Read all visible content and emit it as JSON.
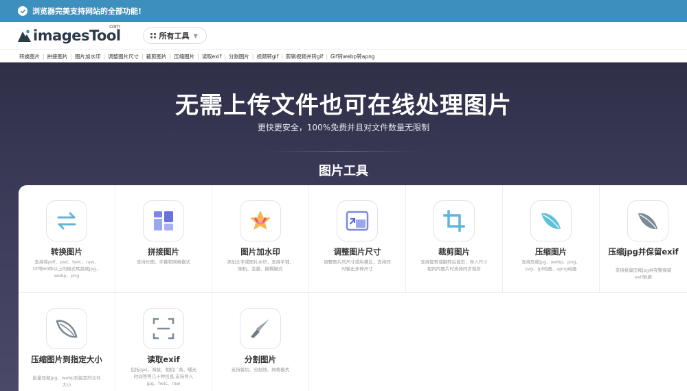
{
  "notice": {
    "text": "浏览器完美支持网站的全部功能!"
  },
  "header": {
    "logo_text": "imagesTool",
    "logo_com": "com",
    "tools_button": "所有工具"
  },
  "subnav": [
    "转换图片",
    "拼接图片",
    "图片加水印",
    "调整图片尺寸",
    "裁剪图片",
    "压缩图片",
    "读取exif",
    "分割图片",
    "视频转gif",
    "剪辑视频并转gif",
    "Gif转webp转apng"
  ],
  "hero": {
    "title": "无需上传文件也可在线处理图片",
    "subtitle": "更快更安全，100%免费并且对文件数量无限制",
    "section_title": "图片工具"
  },
  "tools": [
    {
      "name": "转换图片",
      "desc": "支持将pdf、psd、heic、raw、tiff等60种以上的格式转换成jpg、webp、png",
      "icon": "convert-icon"
    },
    {
      "name": "拼接图片",
      "desc": "支持长图，字幕和网格模式",
      "icon": "collage-icon"
    },
    {
      "name": "图片加水印",
      "desc": "添加文字或图片水印，支持平铺、随机、变量、模糊模式",
      "icon": "watermark-icon"
    },
    {
      "name": "调整图片尺寸",
      "desc": "调整图片的尺寸或纵横比，支持同时输出多种尺寸",
      "icon": "resize-icon"
    },
    {
      "name": "裁剪图片",
      "desc": "支持旋转或翻转后裁剪，导入尺寸相同的图片时支持同步裁剪",
      "icon": "crop-icon"
    },
    {
      "name": "压缩图片",
      "desc": "支持压缩jpg、webp、png、svg、gif动画、apng动画",
      "icon": "compress-icon"
    },
    {
      "name": "压缩jpg并保留exif",
      "desc": "支持批量压缩jpg并完整保留exif数据",
      "icon": "compress-exif-icon"
    },
    {
      "name": "压缩图片到指定大小",
      "desc": "批量压缩jpg、webp到指定的文件大小",
      "icon": "compress-size-icon"
    },
    {
      "name": "读取exif",
      "desc": "包括gps、海拔、相机厂商、曝光时间等等几十种信息,支持导入jpg、heic、raw",
      "icon": "exif-icon"
    },
    {
      "name": "分割图片",
      "desc": "支持裁切、分割线、网格模式",
      "icon": "split-icon"
    }
  ]
}
